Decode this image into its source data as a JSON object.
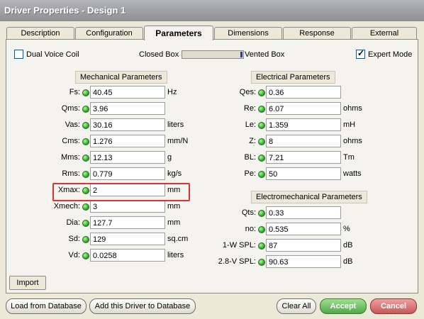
{
  "window": {
    "title": "Driver Properties - Design 1"
  },
  "tabs": [
    {
      "label": "Description"
    },
    {
      "label": "Configuration"
    },
    {
      "label": "Parameters"
    },
    {
      "label": "Dimensions"
    },
    {
      "label": "Response"
    },
    {
      "label": "External"
    }
  ],
  "options": {
    "dual_voice_coil": "Dual Voice Coil",
    "closed_box": "Closed Box",
    "vented_box": "Vented Box",
    "expert_mode": "Expert Mode"
  },
  "mechanical": {
    "title": "Mechanical Parameters",
    "rows": [
      {
        "label": "Fs:",
        "value": "40.45",
        "unit": "Hz"
      },
      {
        "label": "Qms:",
        "value": "3.96",
        "unit": ""
      },
      {
        "label": "Vas:",
        "value": "30.16",
        "unit": "liters"
      },
      {
        "label": "Cms:",
        "value": "1.276",
        "unit": "mm/N"
      },
      {
        "label": "Mms:",
        "value": "12.13",
        "unit": "g"
      },
      {
        "label": "Rms:",
        "value": "0.779",
        "unit": "kg/s"
      },
      {
        "label": "Xmax:",
        "value": "2",
        "unit": "mm"
      },
      {
        "label": "Xmech:",
        "value": "3",
        "unit": "mm"
      },
      {
        "label": "Dia:",
        "value": "127.7",
        "unit": "mm"
      },
      {
        "label": "Sd:",
        "value": "129",
        "unit": "sq.cm"
      },
      {
        "label": "Vd:",
        "value": "0.0258",
        "unit": "liters"
      }
    ]
  },
  "electrical": {
    "title": "Electrical Parameters",
    "rows": [
      {
        "label": "Qes:",
        "value": "0.36",
        "unit": ""
      },
      {
        "label": "Re:",
        "value": "6.07",
        "unit": "ohms"
      },
      {
        "label": "Le:",
        "value": "1.359",
        "unit": "mH"
      },
      {
        "label": "Z:",
        "value": "8",
        "unit": "ohms"
      },
      {
        "label": "BL:",
        "value": "7.21",
        "unit": "Tm"
      },
      {
        "label": "Pe:",
        "value": "50",
        "unit": "watts"
      }
    ]
  },
  "electromechanical": {
    "title": "Electromechanical Parameters",
    "rows": [
      {
        "label": "Qts:",
        "value": "0.33",
        "unit": ""
      },
      {
        "label": "no:",
        "value": "0.535",
        "unit": "%"
      },
      {
        "label": "1-W SPL:",
        "value": "87",
        "unit": "dB"
      },
      {
        "label": "2.8-V SPL:",
        "value": "90.63",
        "unit": "dB"
      }
    ]
  },
  "buttons": {
    "import": "Import",
    "load_db": "Load from Database",
    "add_db": "Add this Driver to Database",
    "clear_all": "Clear All",
    "accept": "Accept",
    "cancel": "Cancel"
  },
  "colors": {
    "accent_green": "#52a84a",
    "cancel_red": "#c65858",
    "highlight_red": "#d9343a"
  }
}
